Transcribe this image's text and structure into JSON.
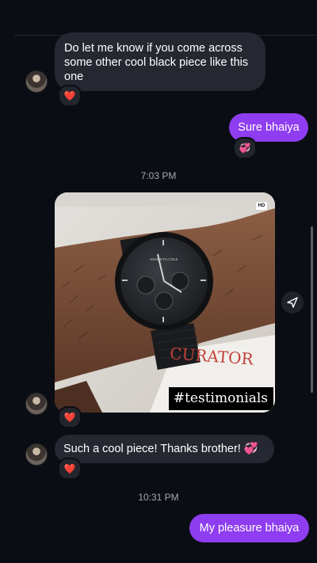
{
  "messages": {
    "m1_text": "Do let me know if you come across some other cool black piece like this one",
    "m1_reaction": "❤️",
    "m2_text": "Sure bhaiya",
    "m2_reaction": "💞",
    "time1": "7:03 PM",
    "photo_badge": "HD",
    "photo_caption": "#testimonials",
    "photo_reaction": "❤️",
    "m3_text": "Such a cool piece! Thanks brother! 💞",
    "m3_reaction": "❤️",
    "time2": "10:31 PM",
    "m4_text": "My pleasure bhaiya"
  },
  "photo_labels": {
    "watch_brand": "KENNETH COLE",
    "box_text": "CURATOR"
  },
  "icons": {
    "share": "share-send-icon",
    "avatar": "sender-avatar"
  },
  "colors": {
    "background": "#0b0d14",
    "incoming_bubble": "#262831",
    "outgoing_bubble": "#8f3df0",
    "timestamp": "#a6a8ae"
  }
}
